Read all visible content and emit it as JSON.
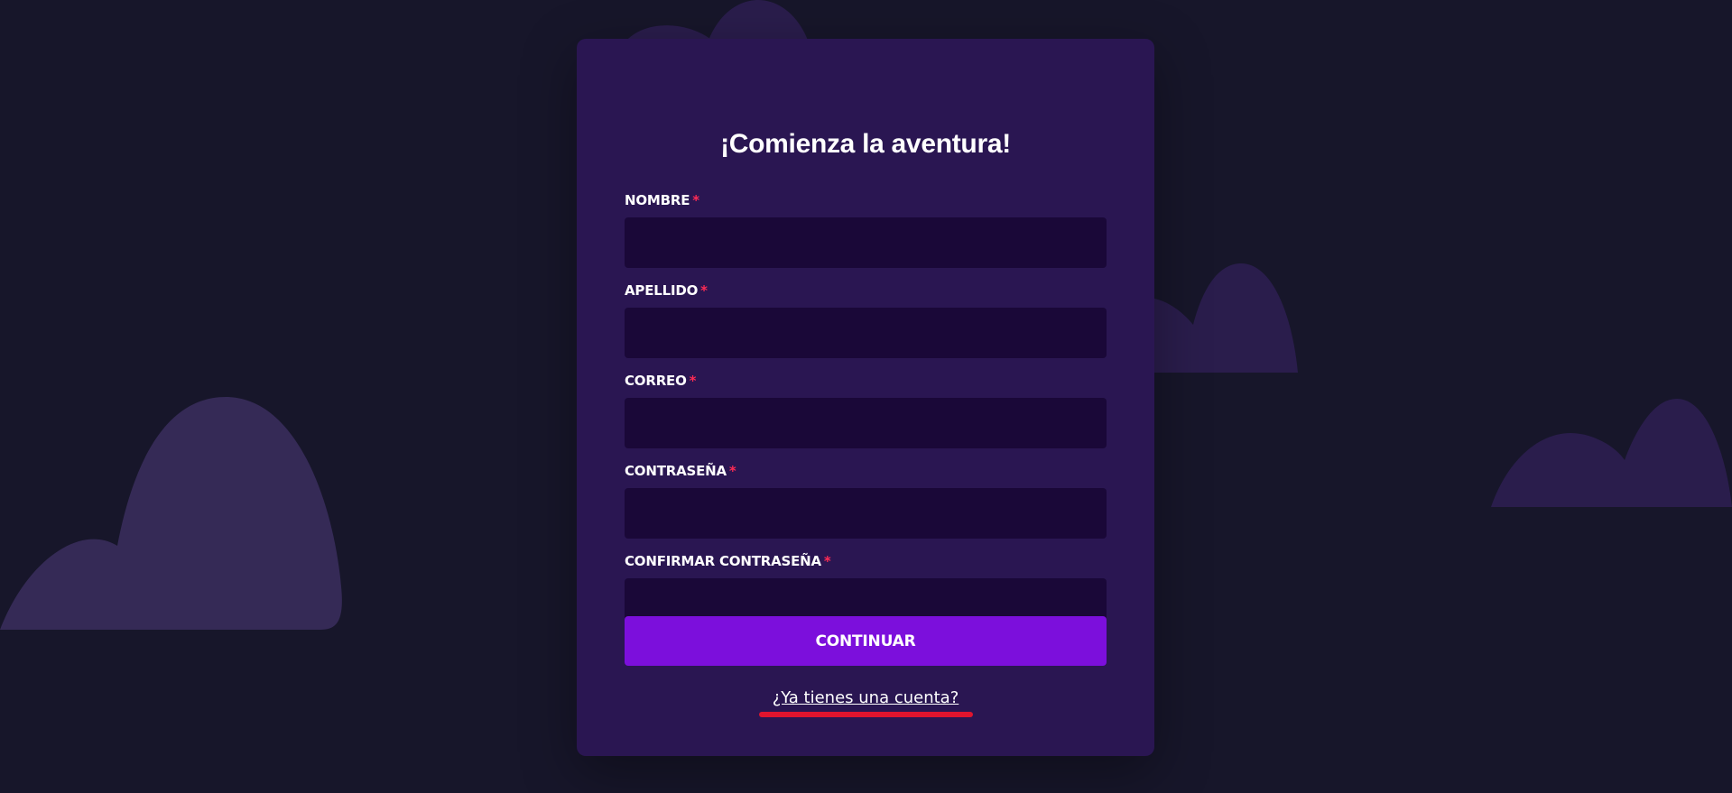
{
  "form": {
    "title": "¡Comienza la aventura!",
    "required_marker": "*",
    "fields": [
      {
        "label": "NOMBRE",
        "value": ""
      },
      {
        "label": "APELLIDO",
        "value": ""
      },
      {
        "label": "CORREO",
        "value": ""
      },
      {
        "label": "CONTRASEÑA",
        "value": ""
      },
      {
        "label": "CONFIRMAR CONTRASEÑA",
        "value": ""
      }
    ],
    "submit_label": "CONTINUAR",
    "login_link": "¿Ya tienes una cuenta?"
  },
  "colors": {
    "background": "#17162a",
    "card": "#2a1652",
    "input": "#1a0838",
    "button": "#7c0fdc",
    "required": "#ff2b55",
    "hill": "#352a56",
    "hill_dark": "#2a1d4c",
    "highlight": "#e0142e"
  }
}
